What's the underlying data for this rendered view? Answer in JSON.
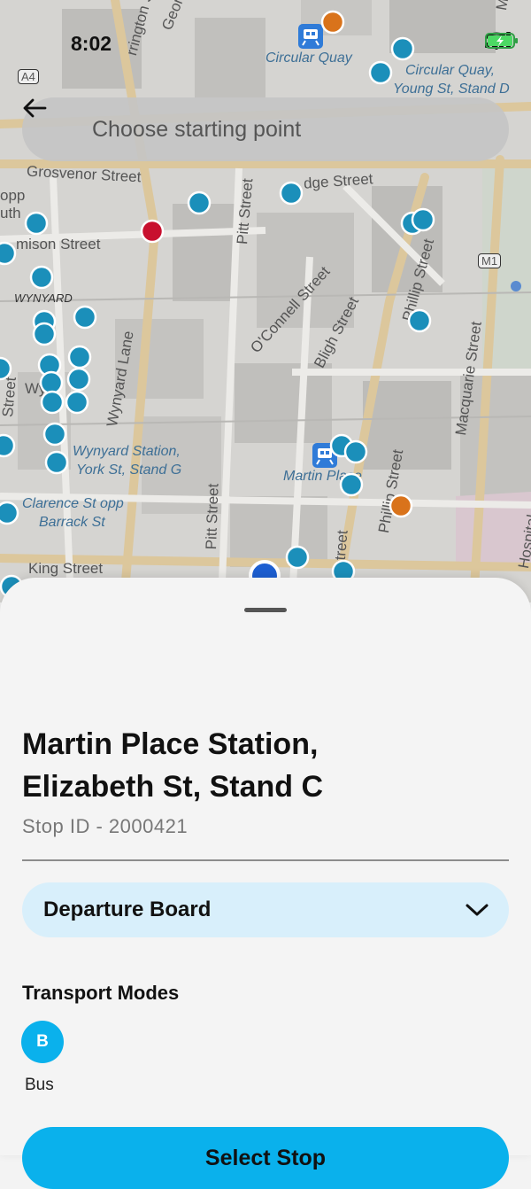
{
  "status_bar": {
    "time": "8:02"
  },
  "search": {
    "placeholder": "Choose starting point",
    "back_icon": "arrow-left-icon"
  },
  "map": {
    "road_shields": [
      "A4",
      "M1"
    ],
    "street_labels": {
      "grosvenor": "Grosvenor Street",
      "bridge": "dge Street",
      "jamison": "mison Street",
      "george": "George Street",
      "harrington": "rrington Street",
      "pitt_north": "Pitt Street",
      "pitt_south": "Pitt Street",
      "oconnell": "O'Connell Street",
      "bligh": "Bligh Street",
      "phillip_north": "Phillip Street",
      "phillip_south": "Phillip Street",
      "macquarie": "Macquarie Street",
      "wynyard_lane": "Wynyard Lane",
      "king": "King Street",
      "castlereagh": "street",
      "hospital": "Hospital",
      "mac_top": "Mac",
      "opp": "opp",
      "uth": "uth",
      "street_left": "Street",
      "wy": "Wy"
    },
    "poi_labels": {
      "circular_quay": "Circular Quay",
      "circular_quay_stand_line1": "Circular Quay,",
      "circular_quay_stand_line2": "Young St, Stand D",
      "wynyard": "WYNYARD",
      "wynyard_station_line1": "Wynyard Station,",
      "wynyard_station_line2": "York St, Stand G",
      "martin_place": "Martin Place",
      "clarence_line1": "Clarence St opp",
      "clarence_line2": "Barrack St"
    },
    "colors": {
      "stop": "#1b8fba",
      "selected": "#c8102e",
      "ferry": "#d9731b",
      "location": "#1d5fd1"
    }
  },
  "sheet": {
    "title_line1": "Martin Place Station,",
    "title_line2": "Elizabeth St, Stand C",
    "stop_id": "Stop ID - 2000421",
    "departure_board": "Departure Board",
    "transport_modes_title": "Transport Modes",
    "modes": [
      {
        "badge": "B",
        "label": "Bus"
      }
    ],
    "select_button": "Select Stop"
  }
}
